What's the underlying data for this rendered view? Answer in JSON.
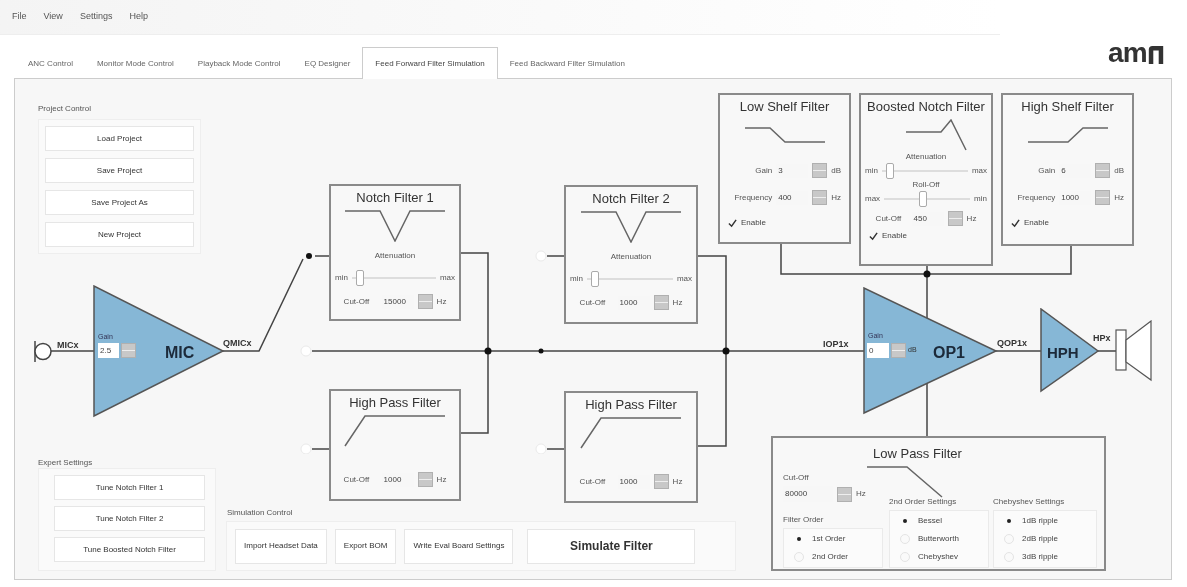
{
  "menu": [
    {
      "label": "File"
    },
    {
      "label": "View"
    },
    {
      "label": "Settings"
    },
    {
      "label": "Help"
    }
  ],
  "tabs": [
    {
      "label": "ANC Control",
      "selected": false
    },
    {
      "label": "Monitor Mode Control",
      "selected": false
    },
    {
      "label": "Playback Mode Control",
      "selected": false
    },
    {
      "label": "EQ Designer",
      "selected": false
    },
    {
      "label": "Feed Forward Filter Simulation",
      "selected": true
    },
    {
      "label": "Feed Backward Filter Simulation",
      "selected": false
    }
  ],
  "logo": "am",
  "project_control": {
    "title": "Project Control",
    "buttons": [
      "Load Project",
      "Save Project",
      "Save Project As",
      "New Project"
    ]
  },
  "expert_settings": {
    "title": "Expert Settings",
    "buttons": [
      "Tune Notch Filter 1",
      "Tune Notch Filter 2",
      "Tune Boosted Notch Filter"
    ]
  },
  "simulation_control": {
    "title": "Simulation Control",
    "buttons": [
      {
        "label": "Import Headset Data",
        "kind": "normal"
      },
      {
        "label": "Export BOM",
        "kind": "normal"
      },
      {
        "label": "Write Eval Board Settings",
        "kind": "normal"
      },
      {
        "label": "Simulate Filter",
        "kind": "primary"
      }
    ]
  },
  "diagram": {
    "mic": {
      "input_label": "MICx",
      "gain_label": "Gain",
      "gain": "2.5",
      "name": "MIC",
      "output_label": "QMICx"
    },
    "filters": [
      {
        "kind": "low_shelf",
        "title": "Low Shelf Filter",
        "gain_label": "Gain",
        "gain": "3",
        "gain_unit": "dB",
        "frequency_label": "Frequency",
        "frequency": "400",
        "frequency_unit": "Hz",
        "enable_label": "Enable",
        "enabled": true
      },
      {
        "kind": "boosted_notch",
        "title": "Boosted Notch Filter",
        "attenuation_label": "Attenuation",
        "attenuation": {
          "left_label": "min",
          "right_label": "max",
          "level": 0.05
        },
        "rolloff_label": "Roll-Off",
        "rolloff": {
          "left_label": "max",
          "right_label": "min",
          "level": 0.45
        },
        "cutoff_label": "Cut-Off",
        "cutoff": "450",
        "cutoff_unit": "Hz",
        "enable_label": "Enable",
        "enabled": true
      },
      {
        "kind": "high_shelf",
        "title": "High Shelf Filter",
        "gain_label": "Gain",
        "gain": "6",
        "gain_unit": "dB",
        "frequency_label": "Frequency",
        "frequency": "1000",
        "frequency_unit": "Hz",
        "enable_label": "Enable",
        "enabled": true
      },
      {
        "kind": "notch",
        "title": "Notch Filter 1",
        "attenuation_label": "Attenuation",
        "attenuation": {
          "left_label": "min",
          "right_label": "max",
          "level": 0.05
        },
        "cutoff_label": "Cut-Off",
        "cutoff": "15000",
        "cutoff_unit": "Hz"
      },
      {
        "kind": "notch",
        "title": "Notch Filter 2",
        "attenuation_label": "Attenuation",
        "attenuation": {
          "left_label": "min",
          "right_label": "max",
          "level": 0.05
        },
        "cutoff_label": "Cut-Off",
        "cutoff": "1000",
        "cutoff_unit": "Hz"
      },
      {
        "kind": "high_pass",
        "title": "High Pass Filter",
        "cutoff_label": "Cut-Off",
        "cutoff": "1000",
        "cutoff_unit": "Hz"
      },
      {
        "kind": "high_pass",
        "title": "High Pass Filter",
        "cutoff_label": "Cut-Off",
        "cutoff": "1000",
        "cutoff_unit": "Hz"
      }
    ],
    "op1": {
      "input_label": "IOP1x",
      "gain_label": "Gain",
      "gain": "0",
      "gain_unit": "dB",
      "name": "OP1",
      "output_label": "QOP1x"
    },
    "hph": {
      "name": "HPH",
      "output_label": "HPx"
    },
    "low_pass": {
      "title": "Low Pass Filter",
      "cutoff_label": "Cut-Off",
      "cutoff": "80000",
      "cutoff_unit": "Hz",
      "groups": [
        {
          "title": "Filter Order",
          "options": [
            {
              "label": "1st Order",
              "selected": true
            },
            {
              "label": "2nd Order",
              "selected": false
            }
          ]
        },
        {
          "title": "2nd Order Settings",
          "options": [
            {
              "label": "Bessel",
              "selected": true
            },
            {
              "label": "Butterworth",
              "selected": false
            },
            {
              "label": "Chebyshev",
              "selected": false
            }
          ]
        },
        {
          "title": "Chebyshev Settings",
          "options": [
            {
              "label": "1dB ripple",
              "selected": true
            },
            {
              "label": "2dB ripple",
              "selected": false
            },
            {
              "label": "3dB ripple",
              "selected": false
            }
          ]
        }
      ]
    }
  }
}
